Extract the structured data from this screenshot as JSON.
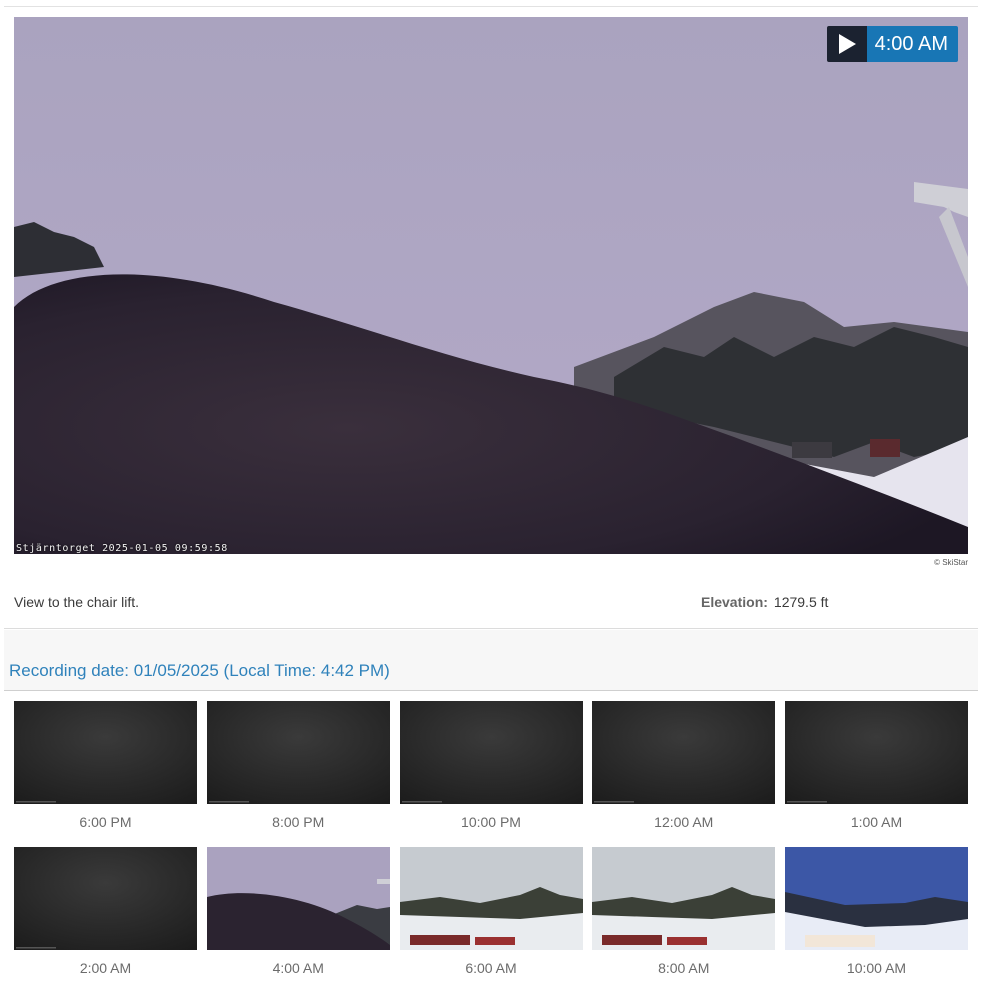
{
  "player": {
    "time_label": "4:00 AM",
    "stamp": "Stjärntorget 2025-01-05 09:59:58",
    "copyright": "© SkiStar"
  },
  "info": {
    "description": "View to the chair lift.",
    "elevation_label": "Elevation:",
    "elevation_value": "1279.5 ft"
  },
  "recording": {
    "label": "Recording date: 01/05/2025 (Local Time: 4:42 PM)"
  },
  "thumbnails": [
    {
      "time": "6:00 PM",
      "scene": "dark"
    },
    {
      "time": "8:00 PM",
      "scene": "dark"
    },
    {
      "time": "10:00 PM",
      "scene": "dark"
    },
    {
      "time": "12:00 AM",
      "scene": "dark"
    },
    {
      "time": "1:00 AM",
      "scene": "dark"
    },
    {
      "time": "2:00 AM",
      "scene": "dark"
    },
    {
      "time": "4:00 AM",
      "scene": "blurry"
    },
    {
      "time": "6:00 AM",
      "scene": "day"
    },
    {
      "time": "8:00 AM",
      "scene": "day"
    },
    {
      "time": "10:00 AM",
      "scene": "blue"
    }
  ]
}
